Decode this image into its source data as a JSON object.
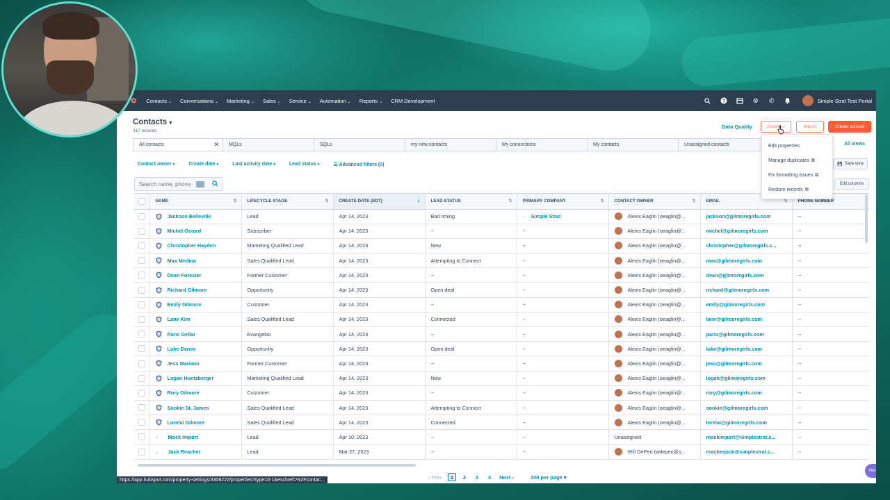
{
  "nav": {
    "items": [
      "Contacts",
      "Conversations",
      "Marketing",
      "Sales",
      "Service",
      "Automation",
      "Reports",
      "CRM Development"
    ],
    "caret_items": [
      true,
      true,
      true,
      true,
      true,
      true,
      true,
      false
    ],
    "portal": "Simple Strat Test Portal"
  },
  "header": {
    "title": "Contacts",
    "records": "317 records",
    "data_quality": "Data Quality",
    "actions": "Actions",
    "import": "Import",
    "create": "Create contact"
  },
  "actions_menu": [
    "Edit properties",
    "Manage duplicates",
    "Fix formatting issues",
    "Restore records"
  ],
  "views": {
    "tabs": [
      "All contacts",
      "MQLs",
      "SQLs",
      "my new contacts",
      "My connections",
      "My contacts",
      "Unassigned contacts"
    ],
    "all_views": "All views",
    "save_view": "Save view"
  },
  "filters": [
    "Contact owner",
    "Create date",
    "Last activity date",
    "Lead status",
    "Advanced filters (0)"
  ],
  "search": {
    "placeholder": "Search name, phone"
  },
  "edit_columns": "Edit columns",
  "table": {
    "columns": [
      "NAME",
      "LIFECYCLE STAGE",
      "CREATE DATE (EDT)",
      "LEAD STATUS",
      "PRIMARY COMPANY",
      "CONTACT OWNER",
      "EMAIL",
      "PHONE NUMBER"
    ],
    "rows": [
      {
        "name": "Jackson Belleville",
        "stage": "Lead",
        "date": "Apr 14, 2023",
        "status": "Bad timing",
        "company": "Simple Strat",
        "owner": "Alexis Eaglin (oeaglin@...",
        "email": "jackson@gilmoregirls.com",
        "phone": "--",
        "icon": "shield"
      },
      {
        "name": "Michel Gerard",
        "stage": "Subscriber",
        "date": "Apr 14, 2023",
        "status": "--",
        "company": "--",
        "owner": "Alexis Eaglin (oeaglin@...",
        "email": "michel@gilmoregirls.com",
        "phone": "--",
        "icon": "shield"
      },
      {
        "name": "Christopher Hayden",
        "stage": "Marketing Qualified Lead",
        "date": "Apr 14, 2023",
        "status": "New",
        "company": "--",
        "owner": "Alexis Eaglin (oeaglin@...",
        "email": "christopher@gilmoregirls.c...",
        "phone": "--",
        "icon": "shield"
      },
      {
        "name": "Max Medina",
        "stage": "Sales Qualified Lead",
        "date": "Apr 14, 2023",
        "status": "Attempting to Connect",
        "company": "--",
        "owner": "Alexis Eaglin (oeaglin@...",
        "email": "max@gilmoregirls.com",
        "phone": "--",
        "icon": "shield"
      },
      {
        "name": "Dean Forester",
        "stage": "Former Customer",
        "date": "Apr 14, 2023",
        "status": "--",
        "company": "--",
        "owner": "Alexis Eaglin (oeaglin@...",
        "email": "dean@gilmoregirls.com",
        "phone": "--",
        "icon": "shield"
      },
      {
        "name": "Richard Gilmore",
        "stage": "Opportunity",
        "date": "Apr 14, 2023",
        "status": "Open deal",
        "company": "--",
        "owner": "Alexis Eaglin (oeaglin@...",
        "email": "richard@gilmoregirls.com",
        "phone": "--",
        "icon": "shield"
      },
      {
        "name": "Emily Gilmore",
        "stage": "Customer",
        "date": "Apr 14, 2023",
        "status": "--",
        "company": "--",
        "owner": "Alexis Eaglin (oeaglin@...",
        "email": "emily@gilmoregirls.com",
        "phone": "--",
        "icon": "shield"
      },
      {
        "name": "Lane Kim",
        "stage": "Sales Qualified Lead",
        "date": "Apr 14, 2023",
        "status": "Connected",
        "company": "--",
        "owner": "Alexis Eaglin (oeaglin@...",
        "email": "lane@gilmoregirls.com",
        "phone": "--",
        "icon": "shield"
      },
      {
        "name": "Paris Gellar",
        "stage": "Evangelist",
        "date": "Apr 14, 2023",
        "status": "--",
        "company": "--",
        "owner": "Alexis Eaglin (oeaglin@...",
        "email": "paris@gilmoregirls.com",
        "phone": "--",
        "icon": "shield"
      },
      {
        "name": "Luke Danes",
        "stage": "Opportunity",
        "date": "Apr 14, 2023",
        "status": "Open deal",
        "company": "--",
        "owner": "Alexis Eaglin (oeaglin@...",
        "email": "luke@gilmoregirls.com",
        "phone": "--",
        "icon": "shield"
      },
      {
        "name": "Jess Mariano",
        "stage": "Former Customer",
        "date": "Apr 14, 2023",
        "status": "--",
        "company": "--",
        "owner": "Alexis Eaglin (oeaglin@...",
        "email": "jess@gilmoregirls.com",
        "phone": "--",
        "icon": "shield"
      },
      {
        "name": "Logan Huntzberger",
        "stage": "Marketing Qualified Lead",
        "date": "Apr 14, 2023",
        "status": "New",
        "company": "--",
        "owner": "Alexis Eaglin (oeaglin@...",
        "email": "logan@gilmoregirls.com",
        "phone": "--",
        "icon": "shield"
      },
      {
        "name": "Rory Gilmore",
        "stage": "Customer",
        "date": "Apr 14, 2023",
        "status": "--",
        "company": "--",
        "owner": "Alexis Eaglin (oeaglin@...",
        "email": "rory@gilmoregirls.com",
        "phone": "--",
        "icon": "shield"
      },
      {
        "name": "Sookie St. James",
        "stage": "Sales Qualified Lead",
        "date": "Apr 14, 2023",
        "status": "Attempting to Connect",
        "company": "--",
        "owner": "Alexis Eaglin (oeaglin@...",
        "email": "sookie@gilmoregirls.com",
        "phone": "--",
        "icon": "shield"
      },
      {
        "name": "Lorelai Gilmore",
        "stage": "Sales Qualified Lead",
        "date": "Apr 14, 2023",
        "status": "Connected",
        "company": "--",
        "owner": "Alexis Eaglin (oeaglin@...",
        "email": "lorelai@gilmoregirls.com",
        "phone": "--",
        "icon": "shield"
      },
      {
        "name": "Mock Import",
        "stage": "Lead",
        "date": "Apr 10, 2023",
        "status": "--",
        "company": "--",
        "owner": "Unassigned",
        "email": "mockimport@simplestrat.c...",
        "phone": "--",
        "icon": "import"
      },
      {
        "name": "Jack Reacher",
        "stage": "Lead",
        "date": "Mar 27, 2023",
        "status": "--",
        "company": "--",
        "owner": "Will DePeri (wdeperi@s...",
        "email": "reacherjack@simplestrat.c...",
        "phone": "--",
        "icon": "import"
      }
    ]
  },
  "pagination": {
    "prev": "Prev",
    "pages": [
      "1",
      "2",
      "3",
      "4"
    ],
    "next": "Next",
    "per_page": "100 per page"
  },
  "status_url": "https://app.hubspot.com/property-settings/3308222/properties?type=0-1&eschref=%2Fcontac...",
  "help": "Hel",
  "colors": {
    "nav_bg": "#2d3e50",
    "accent": "#ff7a59",
    "link": "#0091ae"
  }
}
